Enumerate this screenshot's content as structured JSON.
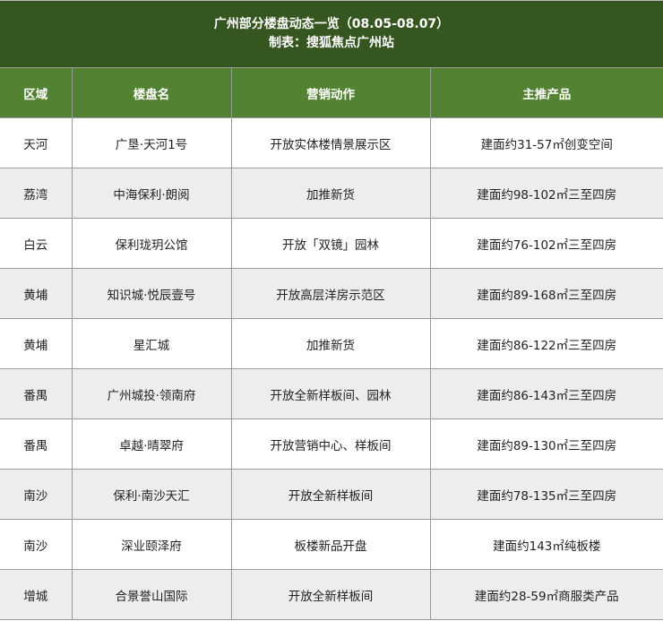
{
  "title": {
    "line1": "广州部分楼盘动态一览（08.05-08.07）",
    "line2": "制表：搜狐焦点广州站"
  },
  "columns": [
    "区域",
    "楼盘名",
    "营销动作",
    "主推产品"
  ],
  "rows": [
    [
      "天河",
      "广垦·天河1号",
      "开放实体楼情景展示区",
      "建面约31-57㎡创变空间"
    ],
    [
      "荔湾",
      "中海保利·朗阅",
      "加推新货",
      "建面约98-102㎡三至四房"
    ],
    [
      "白云",
      "保利珑玥公馆",
      "开放「双镜」园林",
      "建面约76-102㎡三至四房"
    ],
    [
      "黄埔",
      "知识城·悦辰壹号",
      "开放高层洋房示范区",
      "建面约89-168㎡三至四房"
    ],
    [
      "黄埔",
      "星汇城",
      "加推新货",
      "建面约86-122㎡三至四房"
    ],
    [
      "番禺",
      "广州城投·领南府",
      "开放全新样板间、园林",
      "建面约86-143㎡三至四房"
    ],
    [
      "番禺",
      "卓越·晴翠府",
      "开放营销中心、样板间",
      "建面约89-130㎡三至四房"
    ],
    [
      "南沙",
      "保利·南沙天汇",
      "开放全新样板间",
      "建面约78-135㎡三至四房"
    ],
    [
      "南沙",
      "深业颐泽府",
      "板楼新品开盘",
      "建面约143㎡纯板楼"
    ],
    [
      "增城",
      "合景誉山国际",
      "开放全新样板间",
      "建面约28-59㎡商服类产品"
    ]
  ],
  "colors": {
    "title_bg": "#36561f",
    "header_bg": "#538233",
    "alt_row": "#ededed"
  }
}
